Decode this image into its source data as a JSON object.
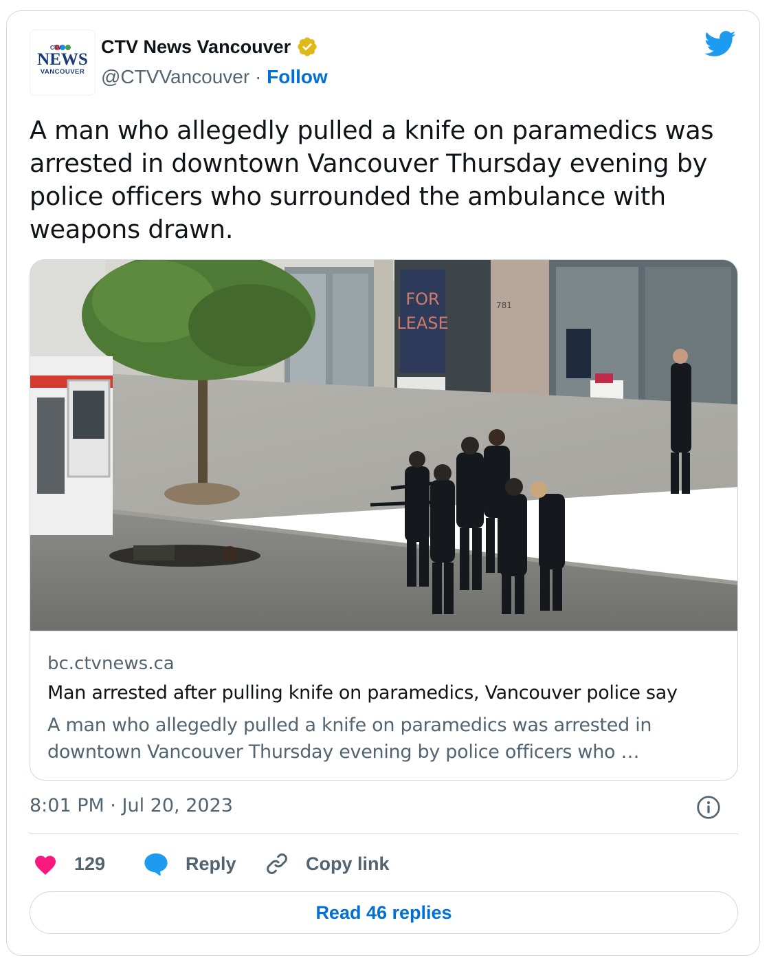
{
  "author": {
    "name": "CTV News Vancouver",
    "handle": "@CTVVancouver",
    "separator": "·",
    "follow_label": "Follow",
    "avatar": {
      "brand_small": "CTV",
      "brand_main": "NEWS",
      "brand_sub": "VANCOUVER"
    }
  },
  "tweet": {
    "text": "A man who allegedly pulled a knife on paramedics was arrested in downtown Vancouver Thursday evening by police officers who surrounded the ambulance with weapons drawn."
  },
  "link_card": {
    "photo_signs": {
      "lease_line1": "FOR",
      "lease_line2": "LEASE",
      "building_number": "781"
    },
    "domain": "bc.ctvnews.ca",
    "title": "Man arrested after pulling knife on paramedics, Vancouver police say",
    "description": "A man who allegedly pulled a knife on paramedics was arrested in downtown Vancouver Thursday evening by police officers who …"
  },
  "meta": {
    "timestamp": "8:01 PM · Jul 20, 2023"
  },
  "actions": {
    "like_count": "129",
    "reply_label": "Reply",
    "copy_link_label": "Copy link"
  },
  "read_replies_label": "Read 46 replies",
  "colors": {
    "accent_blue": "#006fd6",
    "twitter_blue": "#1d9bf0",
    "like_red": "#f91880",
    "verified_gold": "#e2b719",
    "secondary_text": "#536471",
    "border": "#cfd9de"
  },
  "icons": [
    "verified-badge-icon",
    "twitter-bird-icon",
    "info-icon",
    "heart-icon",
    "reply-bubble-icon",
    "link-icon"
  ]
}
